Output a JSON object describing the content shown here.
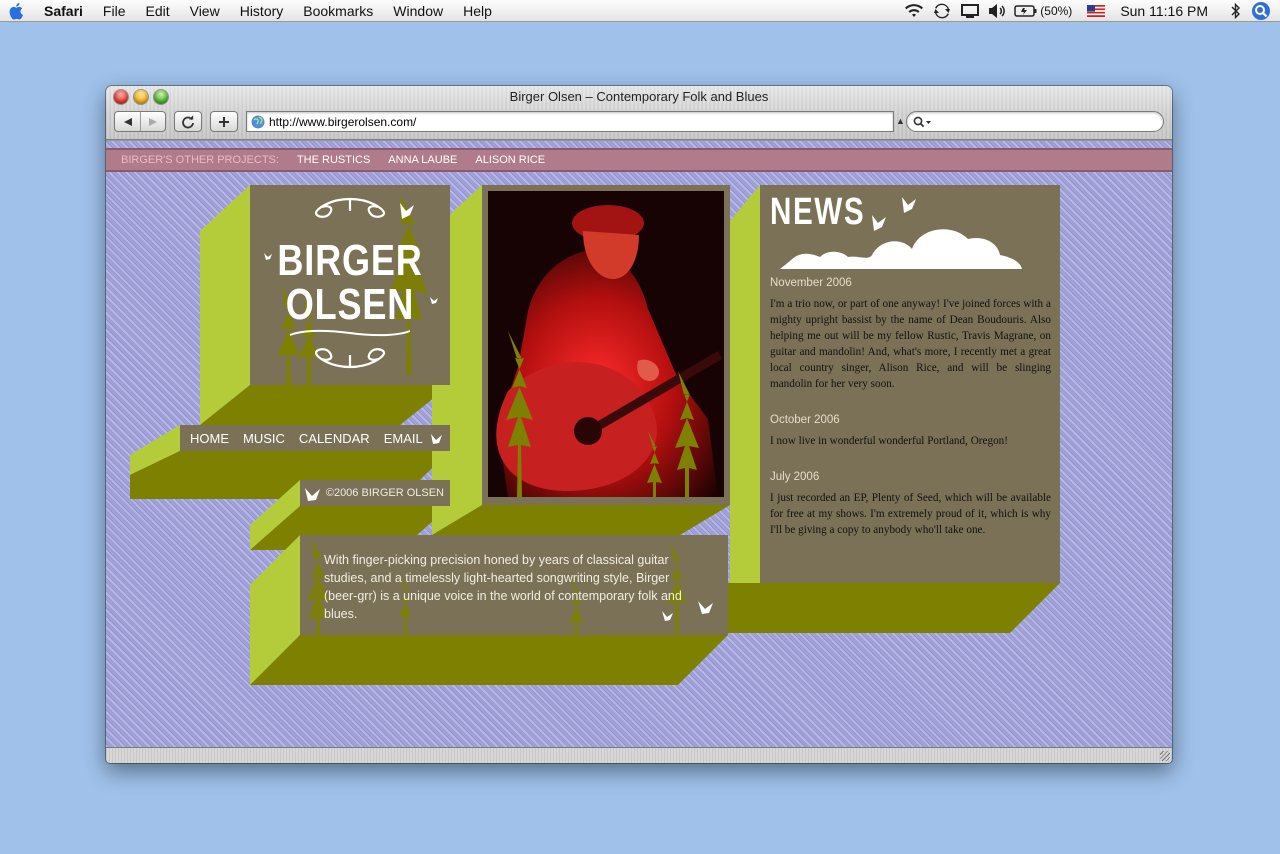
{
  "menubar": {
    "app": "Safari",
    "items": [
      "File",
      "Edit",
      "View",
      "History",
      "Bookmarks",
      "Window",
      "Help"
    ],
    "battery": "(50%)",
    "clock": "Sun 11:16 PM"
  },
  "browser": {
    "title": "Birger Olsen – Contemporary Folk and Blues",
    "url": "http://www.birgerolsen.com/",
    "search_value": ""
  },
  "site": {
    "projects_label": "BIRGER'S OTHER PROJECTS:",
    "projects": [
      "THE RUSTICS",
      "ANNA LAUBE",
      "ALISON RICE"
    ],
    "logo_line1": "BIRGER",
    "logo_line2": "OLSEN",
    "nav": [
      "HOME",
      "MUSIC",
      "CALENDAR",
      "EMAIL"
    ],
    "copyright": "©2006 BIRGER OLSEN",
    "bio": "With finger-picking precision honed by years of classical guitar studies, and a timelessly light-hearted songwriting style, Birger (beer-grr) is a unique voice in the world of contemporary folk and blues.",
    "news_title": "NEWS",
    "news": [
      {
        "date": "November 2006",
        "text": "I'm a trio now, or part of one anyway! I've joined forces with a mighty upright bassist by the name of Dean Boudouris. Also helping me out will be my fellow Rustic, Travis Magrane, on guitar and mandolin! And, what's more, I recently met a great local country singer, Alison Rice, and will be slinging mandolin for her very soon."
      },
      {
        "date": "October 2006",
        "text": "I now live in wonderful wonderful Portland, Oregon!"
      },
      {
        "date": "July 2006",
        "text": "I just recorded an EP, Plenty of Seed, which will be available for free at my shows. I'm extremely proud of it, which is why I'll be giving a copy to anybody who'll take one."
      }
    ]
  },
  "colors": {
    "desktop": "#9fc1ea",
    "panel": "#7b7157",
    "lime": "#b5cc3a",
    "olive": "#7d8000",
    "projects_bar": "#b07b8b"
  }
}
